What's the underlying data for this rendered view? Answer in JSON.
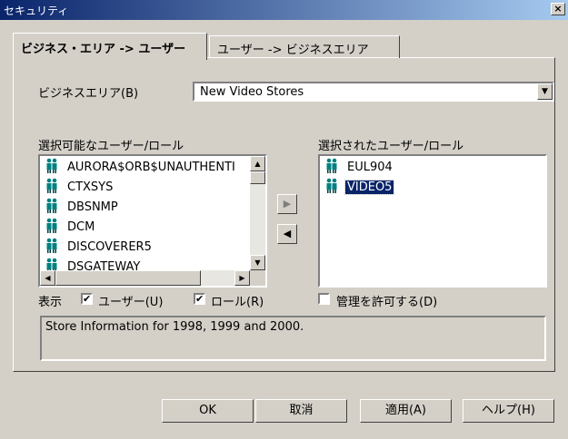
{
  "window": {
    "title": "セキュリティ",
    "close_glyph": "×"
  },
  "tabs": [
    {
      "label": "ビジネス・エリア -> ユーザー",
      "active": true
    },
    {
      "label": "ユーザー -> ビジネスエリア",
      "active": false
    }
  ],
  "business_area": {
    "label": "ビジネスエリア(B)",
    "value": "New Video Stores"
  },
  "available": {
    "label": "選択可能なユーザー/ロール",
    "items": [
      "AURORA$ORB$UNAUTHENTI",
      "CTXSYS",
      "DBSNMP",
      "DCM",
      "DISCOVERER5",
      "DSGATEWAY"
    ]
  },
  "selected": {
    "label": "選択されたユーザー/ロール",
    "items": [
      "EUL904",
      "VIDEO5"
    ],
    "selected_index": 1
  },
  "move_buttons": {
    "add": "▶",
    "remove": "◀"
  },
  "show": {
    "label": "表示",
    "users_label": "ユーザー(U)",
    "users_checked": true,
    "roles_label": "ロール(R)",
    "roles_checked": true
  },
  "allow_admin": {
    "label": "管理を許可する(D)",
    "checked": false
  },
  "description": "Store Information for 1998, 1999 and 2000.",
  "buttons": {
    "ok": "OK",
    "cancel": "取消",
    "apply": "適用(A)",
    "help": "ヘルプ(H)"
  },
  "icons": {
    "user": "user-icon",
    "check": "✔"
  },
  "colors": {
    "titlebar": "#0a246a",
    "selection": "#0a246a",
    "face": "#d4d0c8",
    "user_icon": "#008080"
  }
}
